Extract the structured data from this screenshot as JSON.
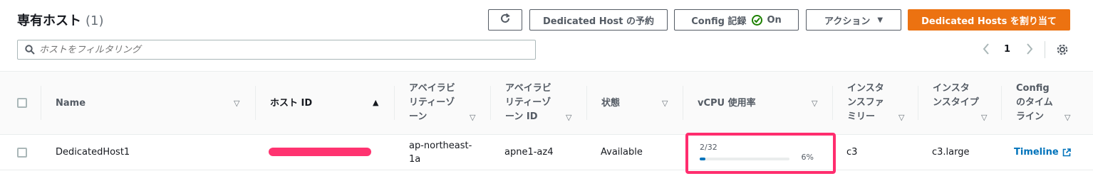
{
  "header": {
    "title": "専有ホスト",
    "count": "(1)"
  },
  "toolbar": {
    "refresh_icon": "refresh-icon",
    "reserve_label": "Dedicated Host の予約",
    "config_label": "Config 記録",
    "config_status": "On",
    "actions_label": "アクション",
    "allocate_label": "Dedicated Hosts を割り当て"
  },
  "search": {
    "placeholder": "ホストをフィルタリング"
  },
  "pagination": {
    "page": "1"
  },
  "table": {
    "columns": [
      "Name",
      "ホスト ID",
      "アベイラビ\nリティーゾ\nーン",
      "アベイラビ\nリティーゾ\nーン ID",
      "状態",
      "vCPU 使用率",
      "インスタ\nンスファ\nミリー",
      "インスタ\nンスタイプ",
      "Config\nのタイム\nライン"
    ],
    "rows": [
      {
        "name": "DedicatedHost1",
        "az": "ap-northeast-\n1a",
        "az_id": "apne1-az4",
        "state": "Available",
        "vcpu_text": "2/32",
        "vcpu_pct": "6%",
        "vcpu_fraction": 0.0625,
        "family": "c3",
        "type": "c3.large",
        "timeline": "Timeline"
      }
    ]
  },
  "colors": {
    "primary": "#ec7211",
    "link": "#0073bb",
    "success": "#1d8102",
    "highlight": "#ff2d6e"
  }
}
